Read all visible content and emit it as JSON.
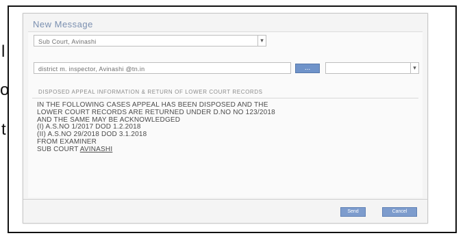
{
  "dialog": {
    "title": "New Message"
  },
  "form": {
    "sub_court_value": "Sub Court, Avinashi",
    "recipient_value": "district m. inspector, Avinashi @tn.in",
    "add_button": "...",
    "secondary_select_value": "",
    "subject": "DISPOSED APPEAL INFORMATION & RETURN OF LOWER COURT RECORDS"
  },
  "message": {
    "line1": "IN THE FOLLOWING CASES APPEAL HAS BEEN DISPOSED AND THE",
    "line2": "LOWER COURT RECORDS ARE RETURNED UNDER D.NO NO 123/2018",
    "line3": "AND THE SAME MAY BE ACKNOWLEDGED",
    "line4": "(I) A.S.NO 1/2017 DOD 1.2.2018",
    "line5": "(II) A.S.NO 29/2018 DOD 3.1.2018",
    "line6": "FROM EXAMINER",
    "line7_prefix": "SUB COURT ",
    "line7_link": "AVINASHI"
  },
  "buttons": {
    "send": "Send",
    "cancel": "Cancel"
  },
  "background": {
    "letters": [
      "l",
      "o",
      "t"
    ]
  },
  "colors": {
    "accent": "#7d9ccd",
    "title": "#7a8fb0"
  }
}
